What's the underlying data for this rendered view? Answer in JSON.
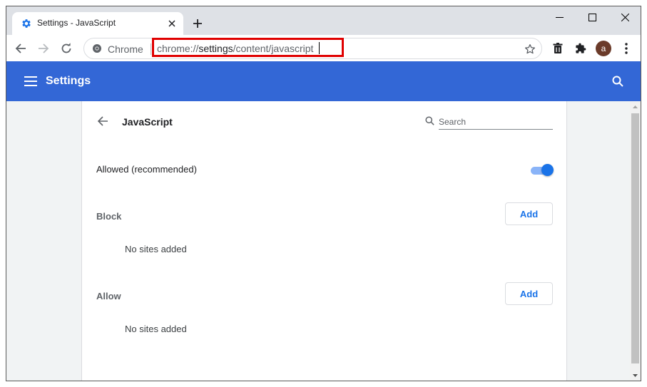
{
  "browser": {
    "tab": {
      "title": "Settings - JavaScript"
    },
    "omnibox": {
      "chip_label": "Chrome",
      "url_scheme": "chrome://",
      "url_host": "settings",
      "url_path": "/content/javascript"
    },
    "profile": {
      "initial": "a",
      "color": "#6b3b2a"
    }
  },
  "settings_header": {
    "title": "Settings",
    "color": "#3367d6"
  },
  "page": {
    "title": "JavaScript",
    "search_placeholder": "Search",
    "allowed_label": "Allowed (recommended)",
    "allowed_toggle_on": true,
    "block": {
      "label": "Block",
      "add_label": "Add",
      "empty_text": "No sites added"
    },
    "allow": {
      "label": "Allow",
      "add_label": "Add",
      "empty_text": "No sites added"
    }
  },
  "colors": {
    "accent": "#1a73e8",
    "highlight_box": "#e00000"
  }
}
